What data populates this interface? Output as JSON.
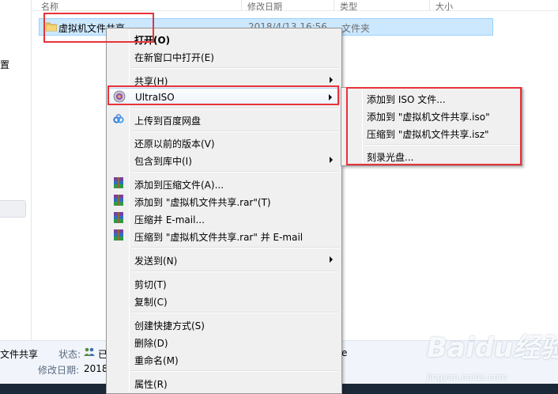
{
  "explorer": {
    "nav_fragment": "置",
    "columns": {
      "name": "名称",
      "date": "修改日期",
      "type": "类型",
      "size": "大小"
    },
    "selected_file": {
      "name": "虚拟机文件共享",
      "date": "2018/4/13 16:56",
      "type": "文件夹"
    },
    "details": {
      "name": "文件共享",
      "status_label": "状态:",
      "status_value": "已",
      "modified_label": "修改日期:",
      "modified_value": "2018",
      "trailing_fragment": "e"
    }
  },
  "context_menu": {
    "items": [
      {
        "label": "打开(O)",
        "bold": true
      },
      {
        "label": "在新窗口中打开(E)"
      },
      {
        "label": "共享(H)",
        "submenu": true
      },
      {
        "label": "UltraISO",
        "submenu": true,
        "icon": "ultraiso-icon",
        "highlighted": true
      },
      {
        "label": "上传到百度网盘",
        "icon": "baidu-netdisk-icon"
      },
      {
        "label": "还原以前的版本(V)"
      },
      {
        "label": "包含到库中(I)",
        "submenu": true
      },
      {
        "label": "添加到压缩文件(A)...",
        "icon": "winrar-icon"
      },
      {
        "label": "添加到 \"虚拟机文件共享.rar\"(T)",
        "icon": "winrar-icon"
      },
      {
        "label": "压缩并 E-mail...",
        "icon": "winrar-icon"
      },
      {
        "label": "压缩到 \"虚拟机文件共享.rar\" 并 E-mail",
        "icon": "winrar-icon"
      },
      {
        "label": "发送到(N)",
        "submenu": true
      },
      {
        "label": "剪切(T)"
      },
      {
        "label": "复制(C)"
      },
      {
        "label": "创建快捷方式(S)"
      },
      {
        "label": "删除(D)"
      },
      {
        "label": "重命名(M)"
      },
      {
        "label": "属性(R)"
      }
    ]
  },
  "ultraiso_submenu": {
    "items": [
      {
        "label": "添加到 ISO 文件..."
      },
      {
        "label": "添加到 \"虚拟机文件共享.iso\""
      },
      {
        "label": "压缩到 \"虚拟机文件共享.isz\""
      },
      {
        "label": "刻录光盘..."
      }
    ]
  },
  "watermark": {
    "brand": "Baidu经验",
    "sub": "经验",
    "url": "jingyan.baidu.com"
  },
  "colors": {
    "highlight_border": "#aecff7",
    "annotation_red": "#e8333a",
    "selection": "#cce8ff"
  }
}
